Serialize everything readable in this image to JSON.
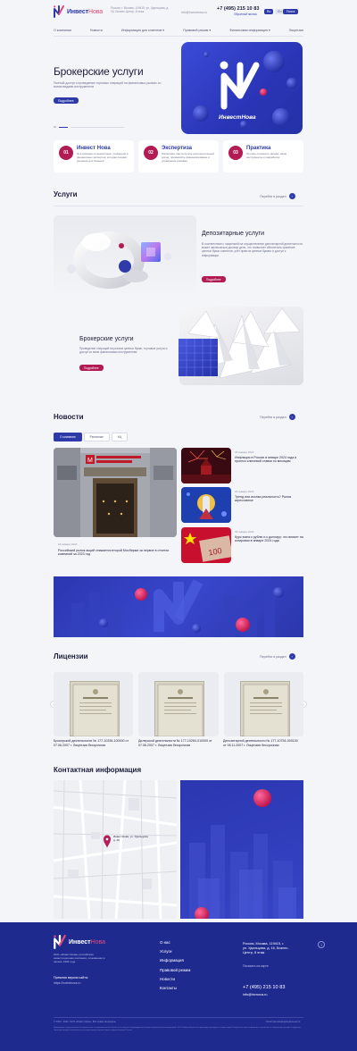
{
  "header": {
    "logo_main": "Инвест",
    "logo_accent": "Нова",
    "address": "Россия, г. Москва, 119415, ул. Удальцова, д. 16, Бизнес-Центр, 8 этаж",
    "email": "info@investnova.ru",
    "phone": "+7 (495) 215 10 83",
    "callback": "Обратный звонок",
    "lang_ru": "Ru",
    "lang_en": "En",
    "search": "Поиск"
  },
  "nav": [
    {
      "label": "О компании",
      "dropdown": false
    },
    {
      "label": "Новости",
      "dropdown": false
    },
    {
      "label": "Информация для клиентов",
      "dropdown": true
    },
    {
      "label": "Правовой режим",
      "dropdown": true
    },
    {
      "label": "Финансовая информация",
      "dropdown": true
    },
    {
      "label": "Лицензии",
      "dropdown": false
    }
  ],
  "hero": {
    "title": "Брокерские услуги",
    "subtitle": "Полный доступ к проведению торговых операций на финансовых рынках со всеми видами инструментов",
    "button": "Подробнее",
    "card_logo_text": "ИнвестНова",
    "slide_num": "01"
  },
  "features": [
    {
      "num": "01",
      "title": "Инвест Нова",
      "text": "Эта команда из аналитиков, трейдеров и финансовых экспертов, которая создаёт решения для бизнеса"
    },
    {
      "num": "02",
      "title": "Экспертиза",
      "text": "Россиянин, как получить дополнительный доход, применяйте финансирование и управление рисками"
    },
    {
      "num": "03",
      "title": "Практика",
      "text": "Лучшие стоимость фонда, наши инструменты и разработки"
    }
  ],
  "services": {
    "title": "Услуги",
    "link": "Перейти в раздел",
    "items": [
      {
        "title": "Депозитарные услуги",
        "text": "В соответствии с лицензией на осуществление депозитарной деятельности может заключаться договор депо, что позволяет обеспечить хранение ценных бумаг клиентов, учёт прав на ценные бумаги и доступ к информации",
        "button": "Подробнее"
      },
      {
        "title": "Брокерские услуги",
        "text": "Проведение операций на рынках ценных бумаг, торговые услуги и доступ ко всем финансовым инструментам",
        "button": "Подробнее"
      }
    ]
  },
  "news": {
    "title": "Новости",
    "link": "Перейти в раздел",
    "tabs": [
      "О компании",
      "Рыночные",
      "КЦ"
    ],
    "main": {
      "date": "18 января 2024",
      "text": "Российский рынок акций снижается второй Мосбиржи за первое в отчетах компаний за 2023 год"
    },
    "items": [
      {
        "date": "18 января 2024",
        "text": "Инфляция в России в январе 2024 года и прогноз ключевой ставки по месяцам"
      },
      {
        "date": "18 января 2024",
        "text": "Тренд или иконка реальность? Рынок агрессивное"
      },
      {
        "date": "18 января 2024",
        "text": "Курс юаня к рублю и к доллару: что влияет на котировки в январе 2024 года"
      }
    ]
  },
  "licenses": {
    "title": "Лицензии",
    "link": "Перейти в раздел",
    "items": [
      {
        "text": "Брокерской деятельности № 177-10336-100000 от 07.06.2007 г. Лицензия бессрочная"
      },
      {
        "text": "Дилерской деятельности № 177-10284-010000 от 07.06.2007 г. Лицензия бессрочная"
      },
      {
        "text": "Депозитарной деятельности № 177-10754-000100 от 05.11.2007 г. Лицензия бессрочная"
      }
    ]
  },
  "contacts": {
    "title": "Контактная информация",
    "map_pin_label": "ИнвестНова, ул. Удальцова, д. 16"
  },
  "footer": {
    "logo_main": "Инвест",
    "logo_accent": "Нова",
    "desc": "2021 «ИнвестНова» российская инвестиционная компания, основанная в начале 1994 года",
    "prev_title": "Прежняя версия сайта:",
    "prev_link": "https://investnova.ru",
    "links": [
      "О нас",
      "Услуги",
      "Информация",
      "Правовой режим",
      "Новости",
      "Контакты"
    ],
    "address": "Россия, Москва, 119415, г. ул. Удальцова, д. 16, Бизнес-Центр, 8 этаж",
    "map_link": "Показать на карте",
    "phone": "+7 (495) 215 10 83",
    "email": "info@invnova.ru",
    "copyright": "© 2004 - 2024, ООО «ИнвестНова». Все права защищены",
    "policy": "Политика конфиденциальности",
    "legal": "Информация представлена исключительно в ознакомительных целях и не является индивидуальной инвестиционной рекомендацией. ООО «ИнвестНова» не гарантирует доходность инвестиций. Результаты инвестирования в прошлом не определяют доходы в будущем. Лицензии профессионального участника рынка ценных бумаг выданы Банком России."
  },
  "colors": {
    "brand_blue": "#2e3aa8",
    "accent_crimson": "#b31b55",
    "footer_bg": "#1f2a8f"
  }
}
